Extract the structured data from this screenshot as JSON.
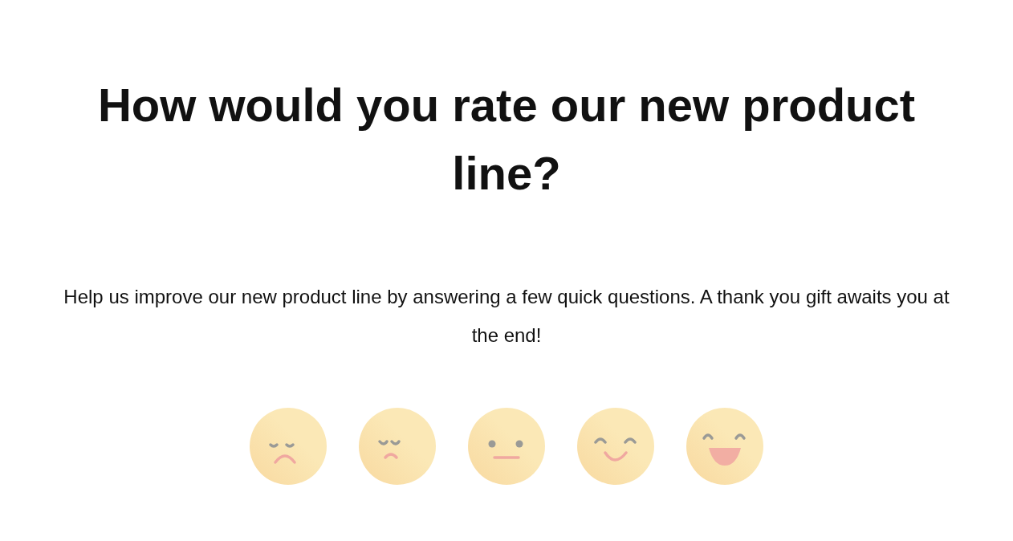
{
  "title": "How would you rate our new product line?",
  "description": "Help us improve our new product line by answering a few quick questions. A thank you gift awaits you at the end!",
  "rating_options": [
    {
      "kind": "very-sad"
    },
    {
      "kind": "sad"
    },
    {
      "kind": "neutral"
    },
    {
      "kind": "happy"
    },
    {
      "kind": "very-happy"
    }
  ]
}
